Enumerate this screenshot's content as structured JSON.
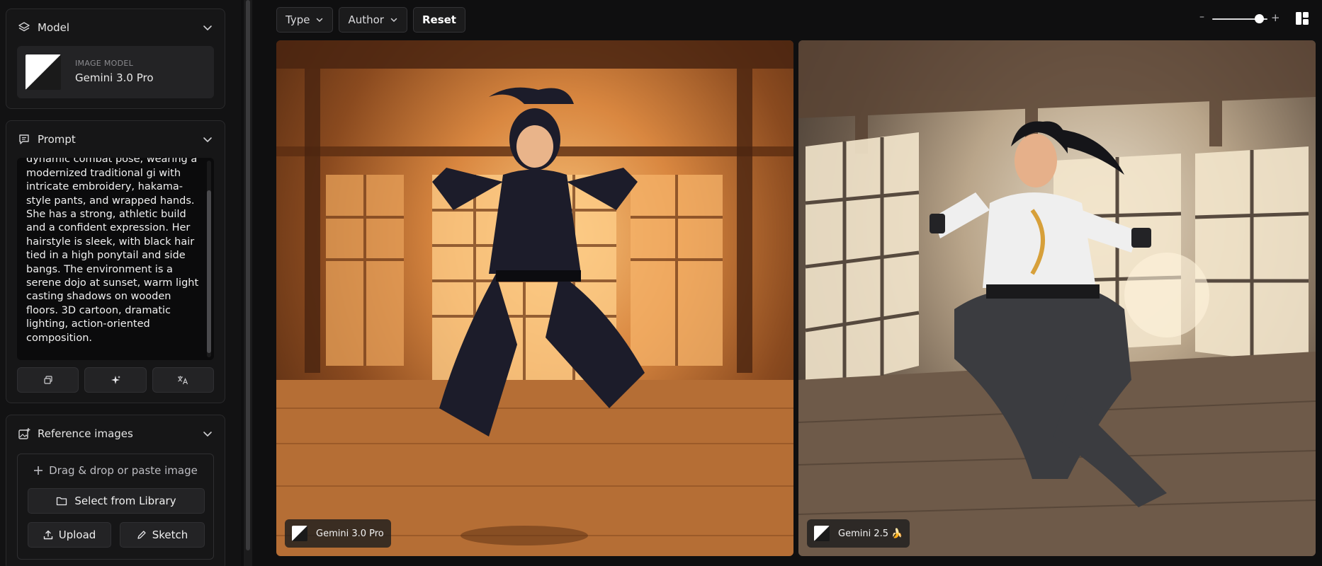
{
  "sidebar": {
    "model": {
      "title": "Model",
      "kicker": "IMAGE MODEL",
      "name": "Gemini 3.0 Pro"
    },
    "prompt": {
      "title": "Prompt",
      "text": "A female martial artist in a dynamic combat pose, wearing a modernized traditional gi with intricate embroidery, hakama-style pants, and wrapped hands. She has a strong, athletic build and a confident expression. Her hairstyle is sleek, with black hair tied in a high ponytail and side bangs. The environment is a serene dojo at sunset, warm light casting shadows on wooden floors. 3D cartoon, dramatic lighting, action-oriented composition."
    },
    "reference": {
      "title": "Reference images",
      "drop_hint": "Drag & drop or paste image",
      "library_label": "Select from Library",
      "upload_label": "Upload",
      "sketch_label": "Sketch"
    }
  },
  "toolbar": {
    "type_label": "Type",
    "author_label": "Author",
    "reset_label": "Reset",
    "zoom_level": 0.8
  },
  "gallery": [
    {
      "model": "Gemini 3.0 Pro"
    },
    {
      "model": "Gemini 2.5 🍌"
    }
  ],
  "colors": {
    "accent": "#ffffff",
    "background": "#0f0f10",
    "panel": "#161617"
  }
}
